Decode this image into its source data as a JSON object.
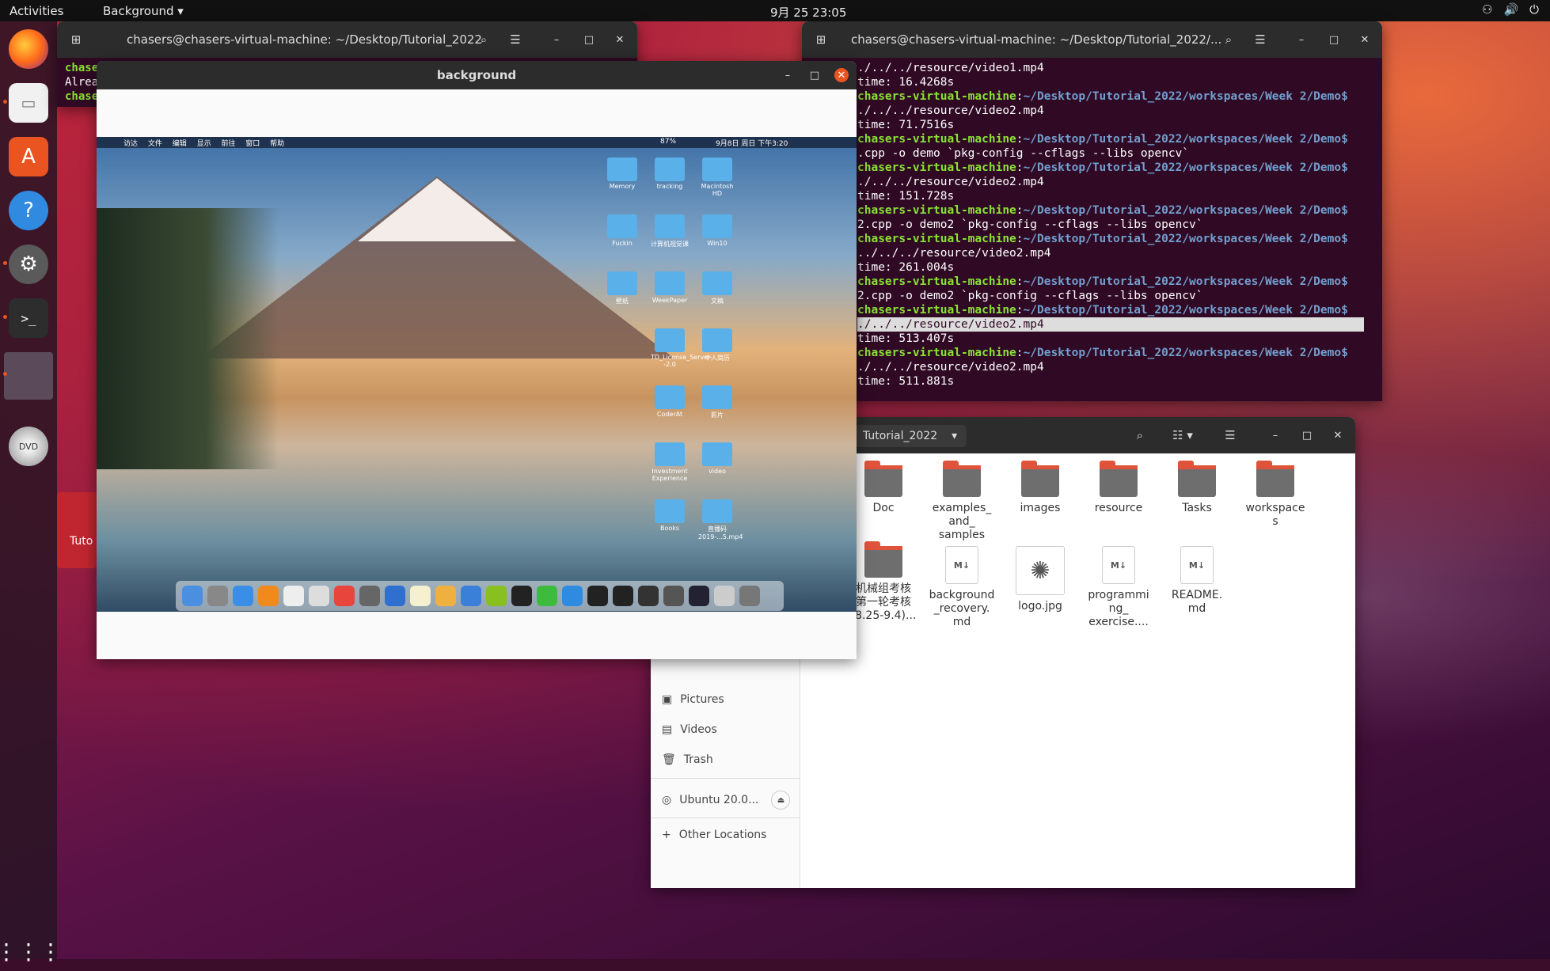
{
  "topbar": {
    "activities": "Activities",
    "app_menu": "Background",
    "clock": "9月 25 23:05",
    "tray": [
      "⚇",
      "🔊",
      "⏻"
    ]
  },
  "dock": {
    "items": [
      "firefox-icon",
      "files-icon",
      "software-icon",
      "help-icon",
      "settings-icon",
      "terminal-icon",
      "app-window-icon",
      "dvd-icon"
    ],
    "apps_grid_icon": "show-applications-icon"
  },
  "terminal_left": {
    "title": "chasers@chasers-virtual-machine: ~/Desktop/Tutorial_2022",
    "lines": [
      "chase",
      "Alrea",
      "chase"
    ]
  },
  "terminal_right": {
    "title": "chasers@chasers-virtual-machine: ~/Desktop/Tutorial_2022/...",
    "user": "chasers-virtual-machine",
    "path": "~/Desktop/Tutorial_2022/workspaces/Week 2/Demo$",
    "lines": [
      {
        "t": "out",
        "text": "./../../resource/video1.mp4"
      },
      {
        "t": "out",
        "text": "time: 16.4268s"
      },
      {
        "t": "prompt"
      },
      {
        "t": "out",
        "text": "./../../resource/video2.mp4"
      },
      {
        "t": "out",
        "text": "time: 71.7516s"
      },
      {
        "t": "prompt"
      },
      {
        "t": "out",
        "text": ".cpp -o demo `pkg-config --cflags --libs opencv`"
      },
      {
        "t": "prompt"
      },
      {
        "t": "out",
        "text": "./../../resource/video2.mp4"
      },
      {
        "t": "out",
        "text": "time: 151.728s"
      },
      {
        "t": "prompt"
      },
      {
        "t": "out",
        "text": "2.cpp -o demo2 `pkg-config --cflags --libs opencv`"
      },
      {
        "t": "prompt"
      },
      {
        "t": "out",
        "text": "../../../resource/video2.mp4"
      },
      {
        "t": "out",
        "text": "time: 261.004s"
      },
      {
        "t": "prompt"
      },
      {
        "t": "out",
        "text": "2.cpp -o demo2 `pkg-config --cflags --libs opencv`"
      },
      {
        "t": "prompt"
      },
      {
        "t": "hl",
        "text": "./../../resource/video2.mp4"
      },
      {
        "t": "out",
        "text": "time: 513.407s"
      },
      {
        "t": "prompt"
      },
      {
        "t": "out",
        "text": "./../../resource/video2.mp4"
      },
      {
        "t": "out",
        "text": "time: 511.881s"
      }
    ]
  },
  "files": {
    "location": "Tutorial_2022",
    "sidebar": [
      "Pictures",
      "Videos",
      "Trash",
      "Ubuntu 20.0...",
      "Other Locations"
    ],
    "items": [
      {
        "name": "Doc",
        "kind": "folder"
      },
      {
        "name": "examples_\nand_\nsamples",
        "kind": "folder"
      },
      {
        "name": "images",
        "kind": "folder"
      },
      {
        "name": "resource",
        "kind": "folder"
      },
      {
        "name": "Tasks",
        "kind": "folder"
      },
      {
        "name": "workspace\ns",
        "kind": "folder"
      },
      {
        "name": "机械组考核\n第一轮考核\n(8.25-9.4)...",
        "kind": "folder"
      },
      {
        "name": "background\n_recovery.\nmd",
        "kind": "md"
      },
      {
        "name": "logo.jpg",
        "kind": "image"
      },
      {
        "name": "programmi\nng_\nexercise....",
        "kind": "md"
      },
      {
        "name": "README.\nmd",
        "kind": "md"
      }
    ],
    "partial_text": [
      "一",
      "4)"
    ]
  },
  "background_window": {
    "title": "background",
    "mac_menu": [
      "访达",
      "文件",
      "编辑",
      "显示",
      "前往",
      "窗口",
      "帮助"
    ],
    "mac_status": "9月8日 周日 下午3:20",
    "mac_battery": "87%",
    "desktop_icons": [
      "Memory",
      "tracking",
      "Macintosh HD",
      "Fuckin",
      "计算机视觉课",
      "Win10",
      "壁纸",
      "WeekPaper",
      "文稿",
      "TD_License_Server--2.0",
      "个人简历",
      "CoderAt",
      "影片",
      "Investment Experience",
      "video",
      "Books",
      "直播码 2019-...5.mp4"
    ]
  },
  "desktop": {
    "tutorial_label": "Tuto"
  },
  "colors": {
    "accent": "#e95420",
    "terminal_bg": "#300a24",
    "prompt_user": "#8ae234",
    "prompt_path": "#729fcf"
  }
}
